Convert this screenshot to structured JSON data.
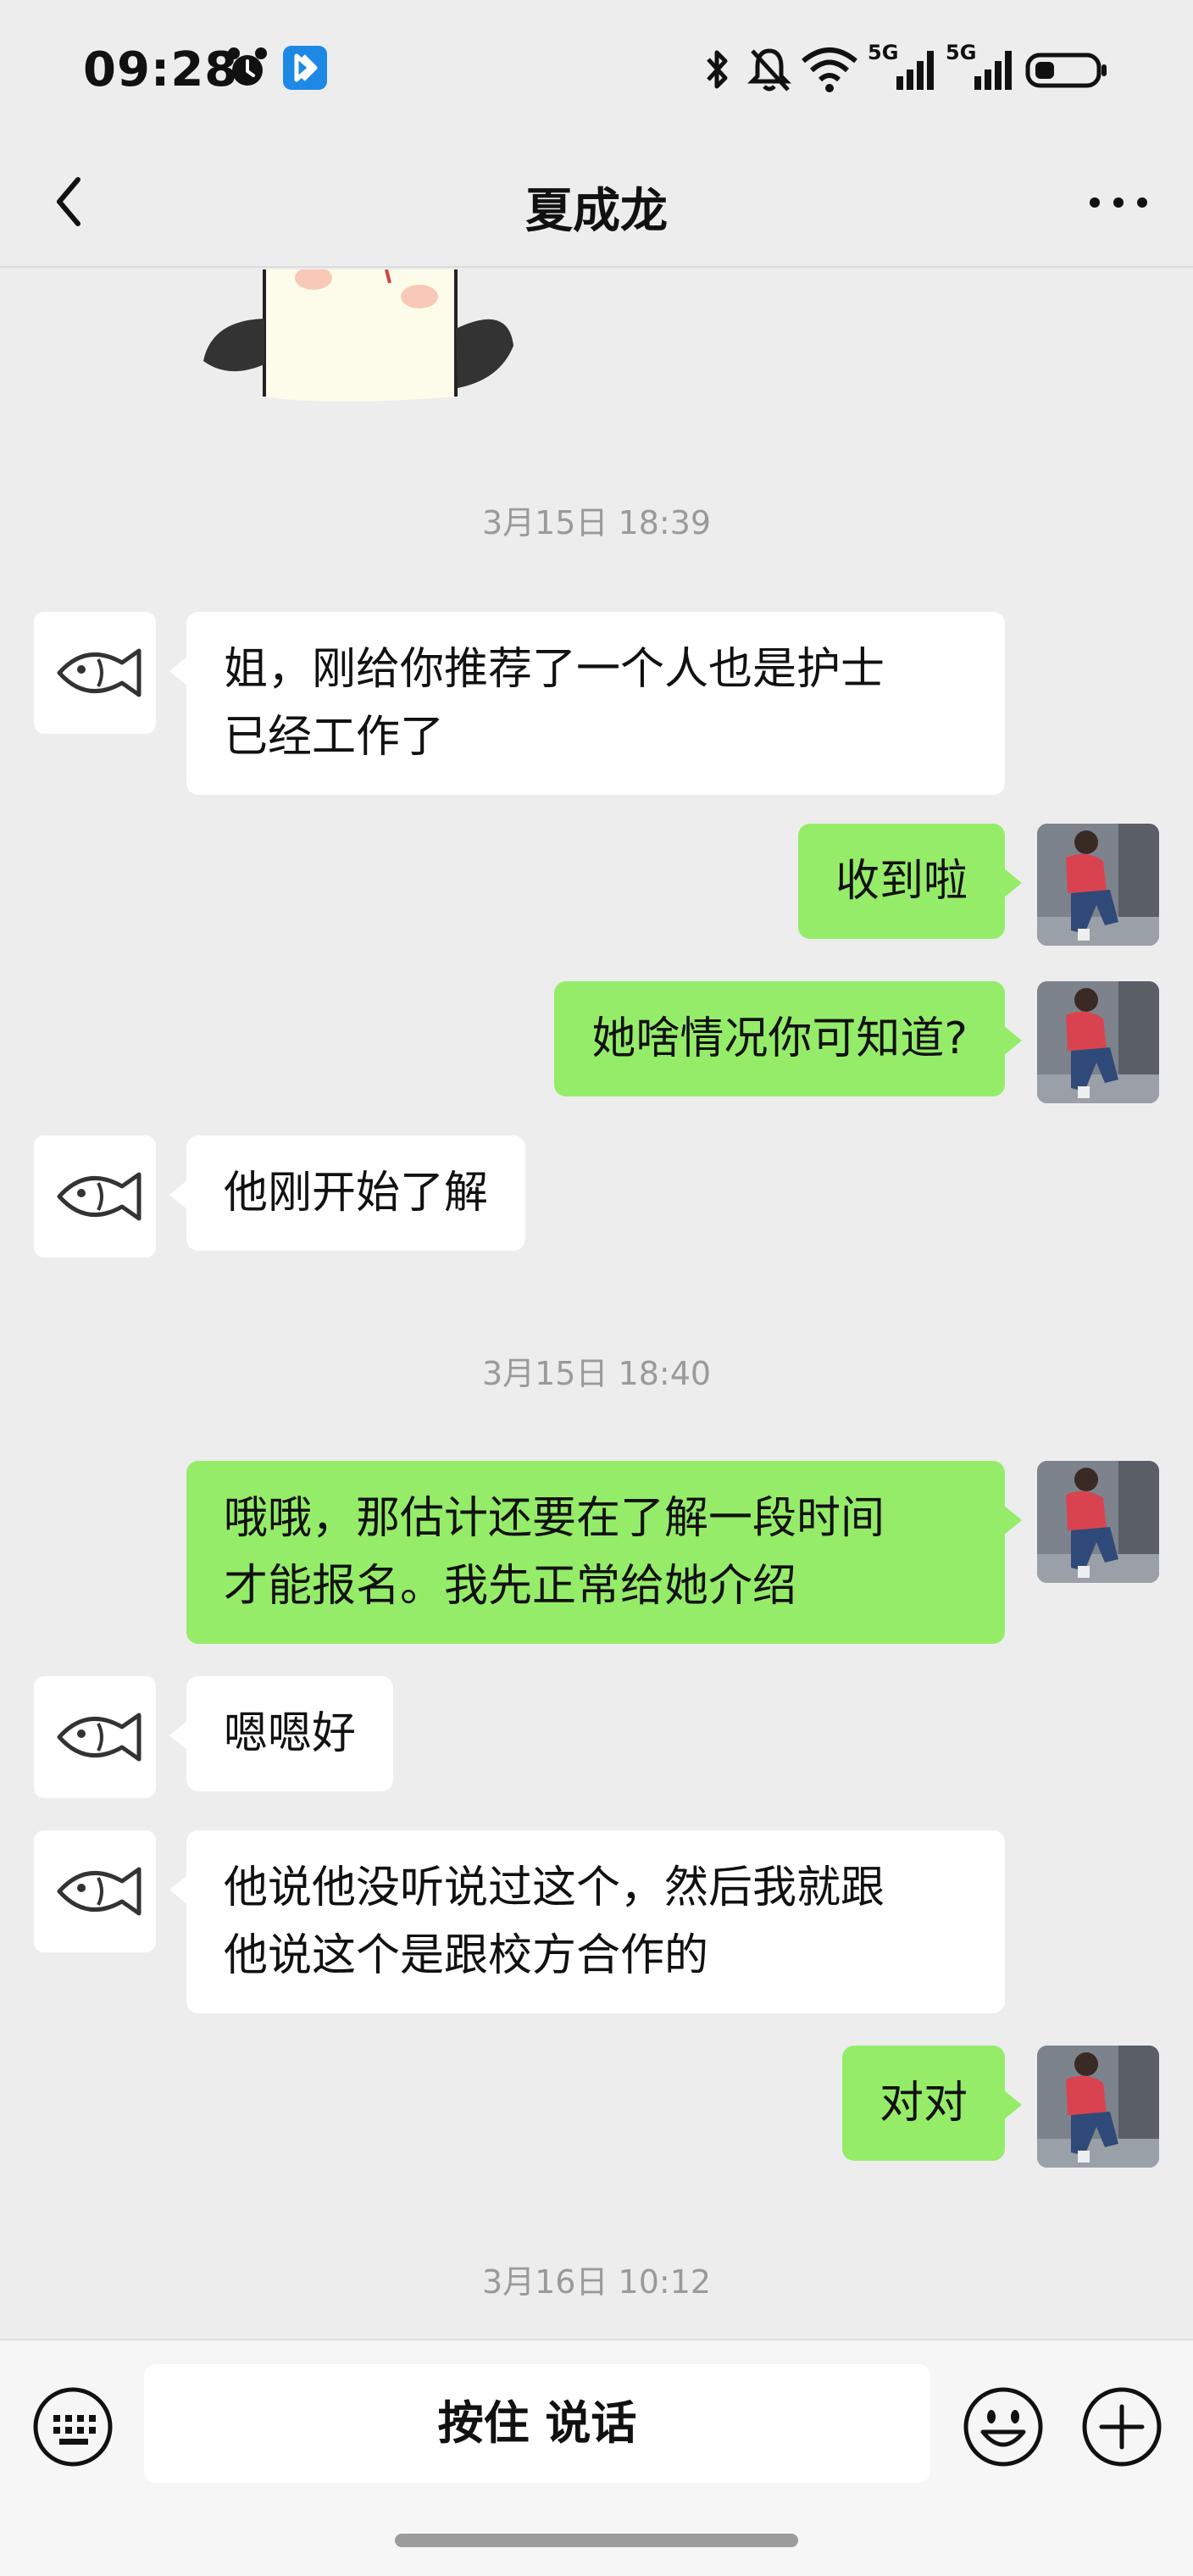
{
  "status_bar": {
    "time": "09:28",
    "icons": [
      "alarm-icon",
      "app-icon",
      "bluetooth-icon",
      "mute-icon",
      "wifi-icon",
      "signal-5g-icon",
      "signal-5g-icon",
      "battery-icon"
    ],
    "network_label_1": "5G",
    "network_label_2": "5G"
  },
  "nav": {
    "title": "夏成龙",
    "back_icon": "chevron-left-icon",
    "more_icon": "more-icon"
  },
  "messages": {
    "ts1": "3月15日 18:39",
    "m1": {
      "line1": "姐，刚给你推荐了一个人也是护士",
      "line2": "已经工作了"
    },
    "m2": "收到啦",
    "m3": "她啥情况你可知道?",
    "m4": "他刚开始了解",
    "ts2": "3月15日 18:40",
    "m5": {
      "line1": "哦哦，那估计还要在了解一段时间",
      "line2": "才能报名。我先正常给她介绍"
    },
    "m6": "嗯嗯好",
    "m7": {
      "line1": "他说他没听说过这个，然后我就跟",
      "line2": "他说这个是跟校方合作的"
    },
    "m8": "对对",
    "ts3": "3月16日 10:12"
  },
  "input_bar": {
    "voice_label": "按住 说话",
    "icons": [
      "keyboard-icon",
      "emoji-icon",
      "plus-icon"
    ]
  },
  "colors": {
    "background": "#ededed",
    "self_bubble": "#95ec69",
    "other_bubble": "#ffffff",
    "timestamp": "#9a9a9a"
  }
}
